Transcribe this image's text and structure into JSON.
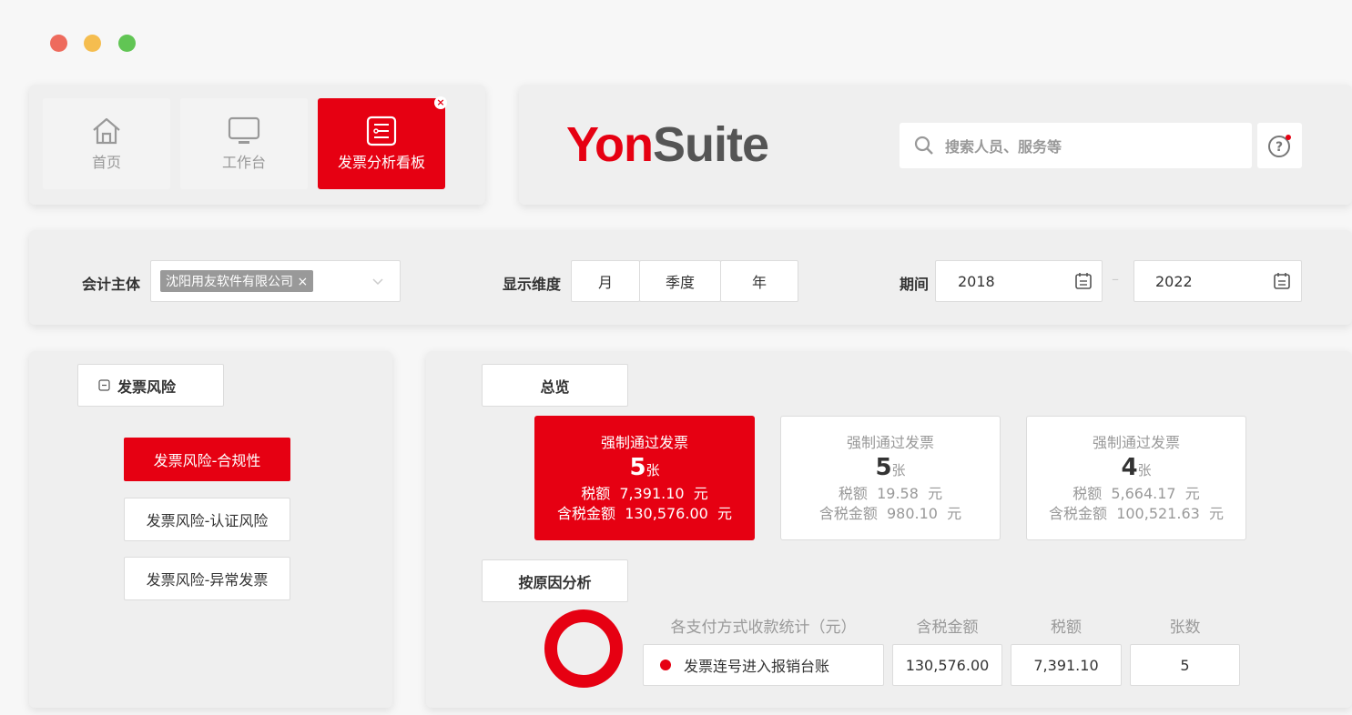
{
  "window": {
    "dots": [
      "#ee6b5d",
      "#f5bd4f",
      "#61c554"
    ]
  },
  "tabs": [
    {
      "label": "首页",
      "icon": "home-icon"
    },
    {
      "label": "工作台",
      "icon": "monitor-icon"
    },
    {
      "label": "发票分析看板",
      "icon": "list-icon",
      "active": true
    }
  ],
  "header": {
    "logo_part1": "Yon",
    "logo_part2": "Suite",
    "search_placeholder": "搜索人员、服务等",
    "brand_color": "#e60012"
  },
  "filters": {
    "entity_label": "会计主体",
    "entity_tag": "沈阳用友软件有限公司 ×",
    "dimension_label": "显示维度",
    "dimension_options": [
      "月",
      "季度",
      "年"
    ],
    "period_label": "期间",
    "period_start": "2018",
    "period_separator": "–",
    "period_end": "2022"
  },
  "sidebar": {
    "group_label": "发票风险",
    "items": [
      {
        "label": "发票风险-合规性",
        "active": true
      },
      {
        "label": "发票风险-认证风险"
      },
      {
        "label": "发票风险-异常发票"
      }
    ]
  },
  "overview": {
    "tab_label": "总览",
    "cards": [
      {
        "title": "强制通过发票",
        "count": "5",
        "unit": "张",
        "tax": "税额  7,391.10  元",
        "total": "含税金额  130,576.00  元"
      },
      {
        "title": "强制通过发票",
        "count": "5",
        "unit": "张",
        "tax": "税额  19.58  元",
        "total": "含税金额  980.10  元"
      },
      {
        "title": "强制通过发票",
        "count": "4",
        "unit": "张",
        "tax": "税额  5,664.17  元",
        "total": "含税金额  100,521.63  元"
      }
    ]
  },
  "analysis": {
    "tab_label": "按原因分析",
    "columns": [
      "各支付方式收款统计（元）",
      "含税金额",
      "税额",
      "张数"
    ],
    "rows": [
      {
        "name": "发票连号进入报销台账",
        "total": "130,576.00",
        "tax": "7,391.10",
        "count": "5"
      }
    ]
  }
}
